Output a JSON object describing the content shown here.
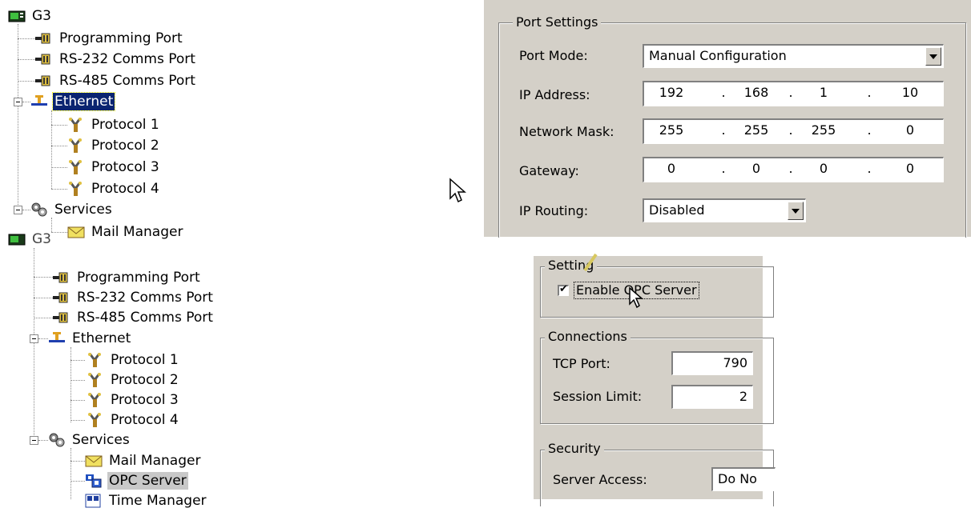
{
  "top_tree": {
    "root": "G3",
    "items": [
      "Programming Port",
      "RS-232 Comms Port",
      "RS-485 Comms Port",
      "Ethernet",
      "Protocol 1",
      "Protocol 2",
      "Protocol 3",
      "Protocol 4",
      "Services",
      "Mail Manager"
    ]
  },
  "bottom_tree": {
    "root": "G3",
    "items": [
      "Programming Port",
      "RS-232 Comms Port",
      "RS-485 Comms Port",
      "Ethernet",
      "Protocol 1",
      "Protocol 2",
      "Protocol 3",
      "Protocol 4",
      "Services",
      "Mail Manager",
      "OPC Server",
      "Time Manager"
    ]
  },
  "port_settings": {
    "legend": "Port Settings",
    "port_mode_label": "Port Mode:",
    "port_mode_value": "Manual Configuration",
    "ip_address_label": "IP Address:",
    "ip_address": [
      "192",
      "168",
      "1",
      "10"
    ],
    "network_mask_label": "Network Mask:",
    "network_mask": [
      "255",
      "255",
      "255",
      "0"
    ],
    "gateway_label": "Gateway:",
    "gateway": [
      "0",
      "0",
      "0",
      "0"
    ],
    "ip_routing_label": "IP Routing:",
    "ip_routing_value": "Disabled",
    "ip_separator": "."
  },
  "opc_panel": {
    "settings_legend": "Setting",
    "enable_label": "Enable OPC Server",
    "enable_checked": true,
    "connections_legend": "Connections",
    "tcp_port_label": "TCP Port:",
    "tcp_port_value": "790",
    "session_limit_label": "Session Limit:",
    "session_limit_value": "2",
    "security_legend": "Security",
    "server_access_label": "Server Access:",
    "server_access_value": "Do No"
  }
}
